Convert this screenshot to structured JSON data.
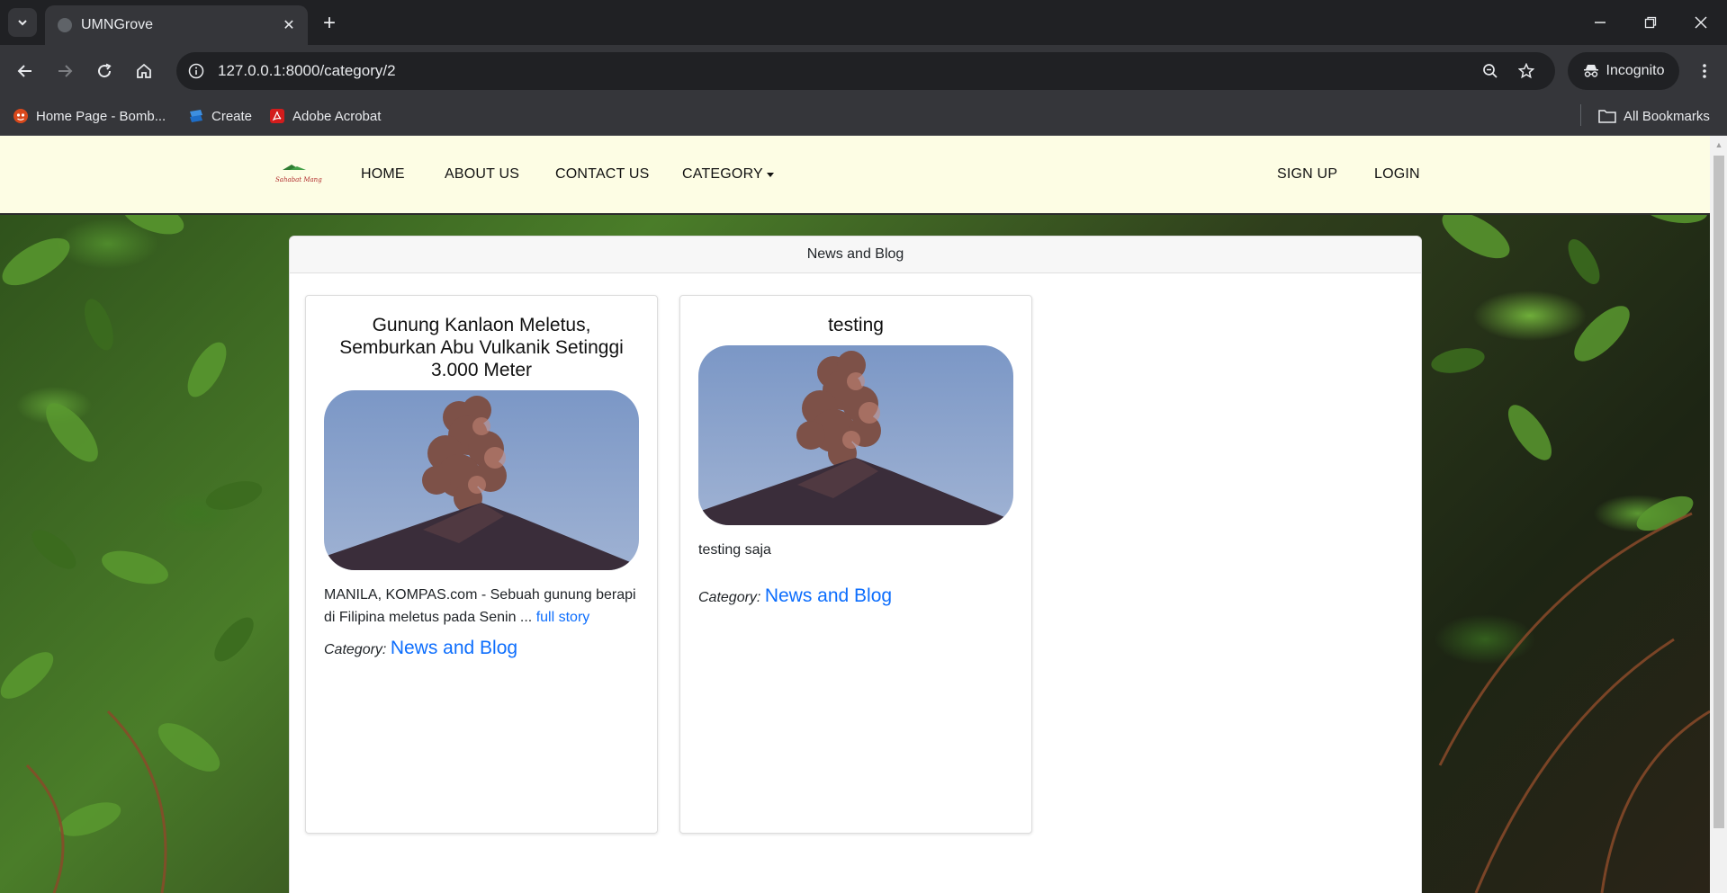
{
  "browser": {
    "tab_title": "UMNGrove",
    "url": "127.0.0.1:8000/category/2",
    "incognito_label": "Incognito",
    "bookmarks": [
      "Home Page - Bomb...",
      "Create",
      "Adobe Acrobat"
    ],
    "all_bookmarks": "All Bookmarks"
  },
  "nav": {
    "logo_text": "Sahabat Mangrove",
    "home": "HOME",
    "about": "ABOUT US",
    "contact": "CONTACT US",
    "category": "CATEGORY",
    "signup": "SIGN UP",
    "login": "LOGIN"
  },
  "main": {
    "header": "News and Blog",
    "posts": [
      {
        "title": "Gunung Kanlaon Meletus, Semburkan Abu Vulkanik Setinggi 3.000 Meter",
        "excerpt": "MANILA, KOMPAS.com - Sebuah gunung berapi di Filipina meletus pada Senin ...",
        "link": "full story",
        "category_label": "Category:",
        "category": "News and Blog"
      },
      {
        "title": "testing",
        "excerpt": "testing saja",
        "category_label": "Category:",
        "category": "News and Blog"
      }
    ]
  }
}
